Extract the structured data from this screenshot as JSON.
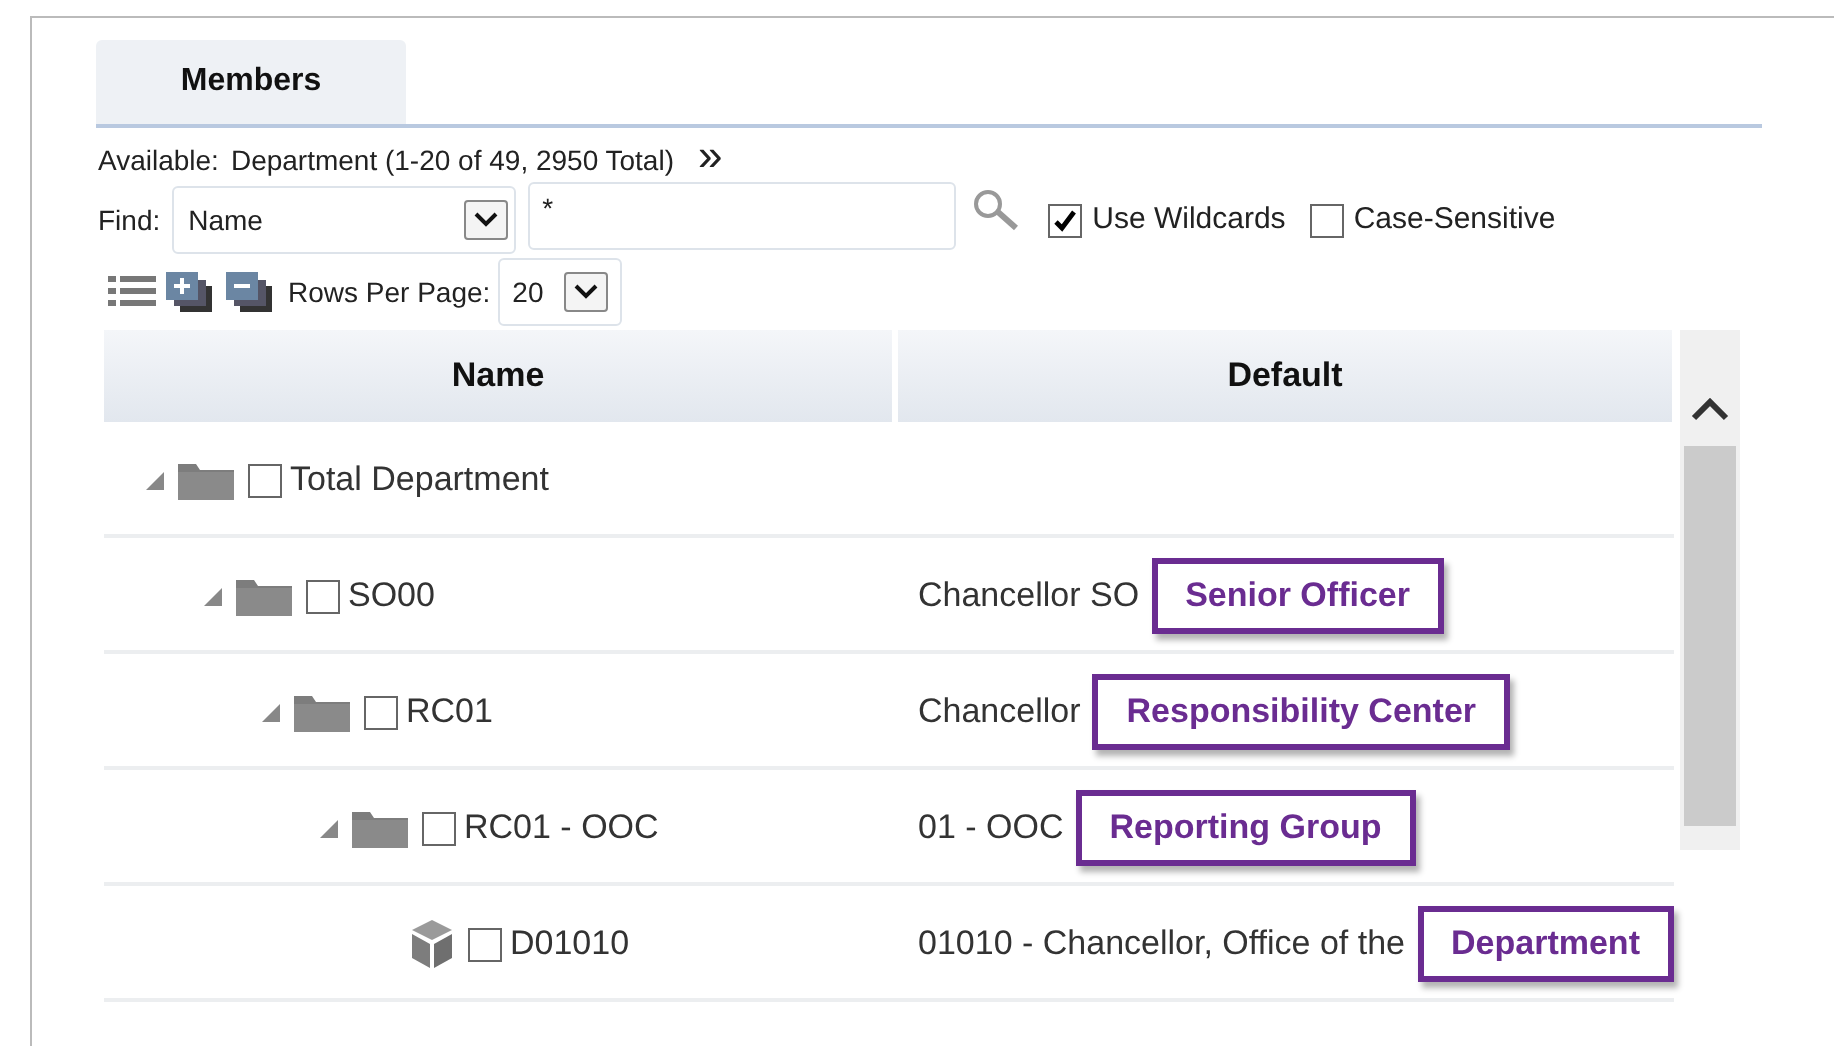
{
  "tabs": [
    {
      "label": "Members",
      "selected": true
    }
  ],
  "available": {
    "label": "Available:",
    "value": "Department (1-20 of 49, 2950 Total)",
    "more": "»"
  },
  "find": {
    "label": "Find:",
    "field": "Name",
    "value": "*"
  },
  "options": [
    {
      "label": "Use Wildcards",
      "checked": true
    },
    {
      "label": "Case-Sensitive",
      "checked": false
    }
  ],
  "rows_per_page": {
    "label": "Rows Per Page:",
    "value": "20"
  },
  "table": {
    "columns": [
      "Name",
      "Default"
    ],
    "rows": [
      {
        "name": "Total Department",
        "kind": "folder",
        "expanded": true,
        "checked": false,
        "default": "",
        "children": [
          {
            "name": "SO00",
            "kind": "folder",
            "expanded": true,
            "checked": false,
            "default": "Chancellor SO",
            "callout": "Senior Officer",
            "children": [
              {
                "name": "RC01",
                "kind": "folder",
                "expanded": true,
                "checked": false,
                "default": "Chancellor",
                "callout": "Responsibility Center",
                "children": [
                  {
                    "name": "RC01 - OOC",
                    "kind": "folder",
                    "expanded": true,
                    "checked": false,
                    "default": "01 - OOC",
                    "callout": "Reporting Group",
                    "children": [
                      {
                        "name": "D01010",
                        "kind": "member",
                        "checked": false,
                        "default": "01010 - Chancellor, Office of the",
                        "callout": "Department"
                      }
                    ]
                  }
                ]
              }
            ]
          }
        ]
      }
    ]
  }
}
